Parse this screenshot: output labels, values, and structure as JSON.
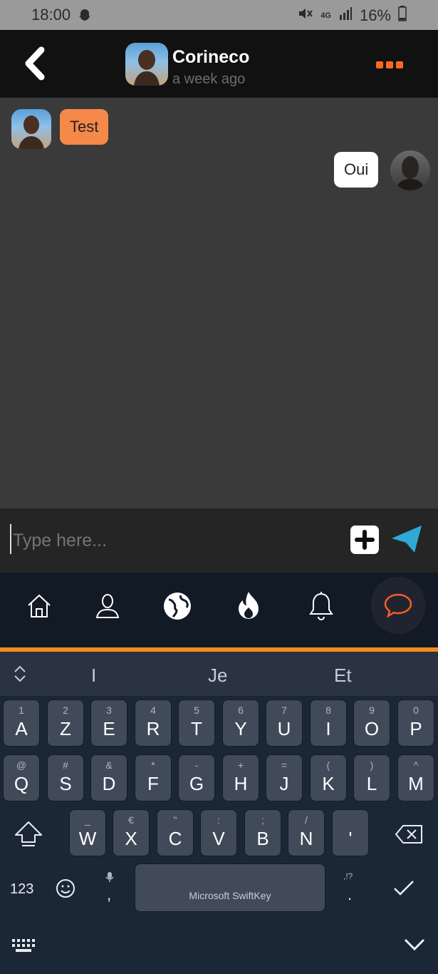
{
  "status_bar": {
    "time": "18:00",
    "battery": "16%",
    "signal_text": "4G",
    "icons": [
      "snapchat-icon",
      "mute-icon",
      "signal-icon",
      "battery-icon"
    ]
  },
  "header": {
    "title": "Corineco",
    "subtitle": "a week ago",
    "back_icon": "chevron-left-icon",
    "more_icon": "more-dots-icon"
  },
  "messages": [
    {
      "text": "Test",
      "side": "left",
      "bubble_color": "#f5894a"
    },
    {
      "text": "Oui",
      "side": "right",
      "bubble_color": "#ffffff"
    }
  ],
  "input": {
    "placeholder": "Type here...",
    "add_icon": "plus-square-icon",
    "send_icon": "send-icon"
  },
  "bottom_nav": {
    "items": [
      "home-icon",
      "profile-icon",
      "globe-icon",
      "flame-icon",
      "bell-icon",
      "chat-icon"
    ],
    "active": "chat-icon",
    "accent": "#f28c1b"
  },
  "keyboard": {
    "suggestions": [
      "I",
      "Je",
      "Et"
    ],
    "row1": [
      {
        "main": "A",
        "sub": "1"
      },
      {
        "main": "Z",
        "sub": "2"
      },
      {
        "main": "E",
        "sub": "3"
      },
      {
        "main": "R",
        "sub": "4"
      },
      {
        "main": "T",
        "sub": "5"
      },
      {
        "main": "Y",
        "sub": "6"
      },
      {
        "main": "U",
        "sub": "7"
      },
      {
        "main": "I",
        "sub": "8"
      },
      {
        "main": "O",
        "sub": "9"
      },
      {
        "main": "P",
        "sub": "0"
      }
    ],
    "row2": [
      {
        "main": "Q",
        "sub": "@"
      },
      {
        "main": "S",
        "sub": "#"
      },
      {
        "main": "D",
        "sub": "&"
      },
      {
        "main": "F",
        "sub": "*"
      },
      {
        "main": "G",
        "sub": "-"
      },
      {
        "main": "H",
        "sub": "+"
      },
      {
        "main": "J",
        "sub": "="
      },
      {
        "main": "K",
        "sub": "("
      },
      {
        "main": "L",
        "sub": ")"
      },
      {
        "main": "M",
        "sub": "^"
      }
    ],
    "row3": [
      {
        "main": "W",
        "sub": "_"
      },
      {
        "main": "X",
        "sub": "€"
      },
      {
        "main": "C",
        "sub": "\""
      },
      {
        "main": "V",
        "sub": ":"
      },
      {
        "main": "B",
        "sub": ";"
      },
      {
        "main": "N",
        "sub": "/"
      },
      {
        "main": "'",
        "sub": ""
      }
    ],
    "numbers_label": "123",
    "comma_label": ",",
    "period_label": ".",
    "punct_hint": ",!?",
    "space_label": "Microsoft SwiftKey"
  }
}
